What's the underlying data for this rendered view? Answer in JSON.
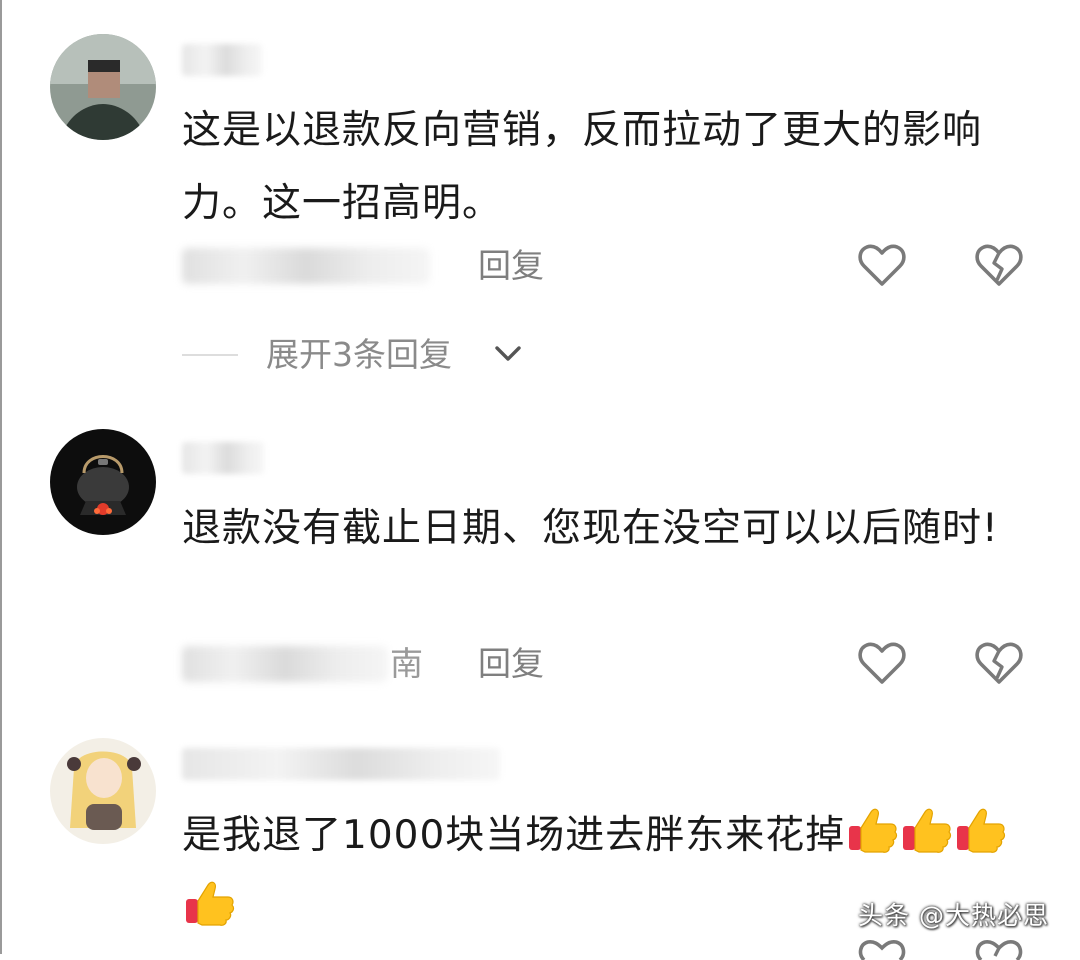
{
  "comments": [
    {
      "content": "这是以退款反向营销，反而拉动了更大的影响力。这一招高明。",
      "reply_label": "回复",
      "location_tail": "",
      "expand_label": "展开3条回复"
    },
    {
      "content": "退款没有截止日期、您现在没空可以以后随时!",
      "reply_label": "回复",
      "location_tail": "南"
    },
    {
      "content": "是我退了1000块当场进去胖东来花掉"
    }
  ],
  "icons": {
    "like": "heart-outline-icon",
    "dislike": "broken-heart-icon",
    "expand": "chevron-down-icon",
    "emoji": "thumbs-up-emoji"
  },
  "watermark": "头条 @大热必思",
  "colors": {
    "text": "#1a1a1a",
    "muted": "#9a9a9a",
    "icon_stroke": "#7a7a7a"
  }
}
